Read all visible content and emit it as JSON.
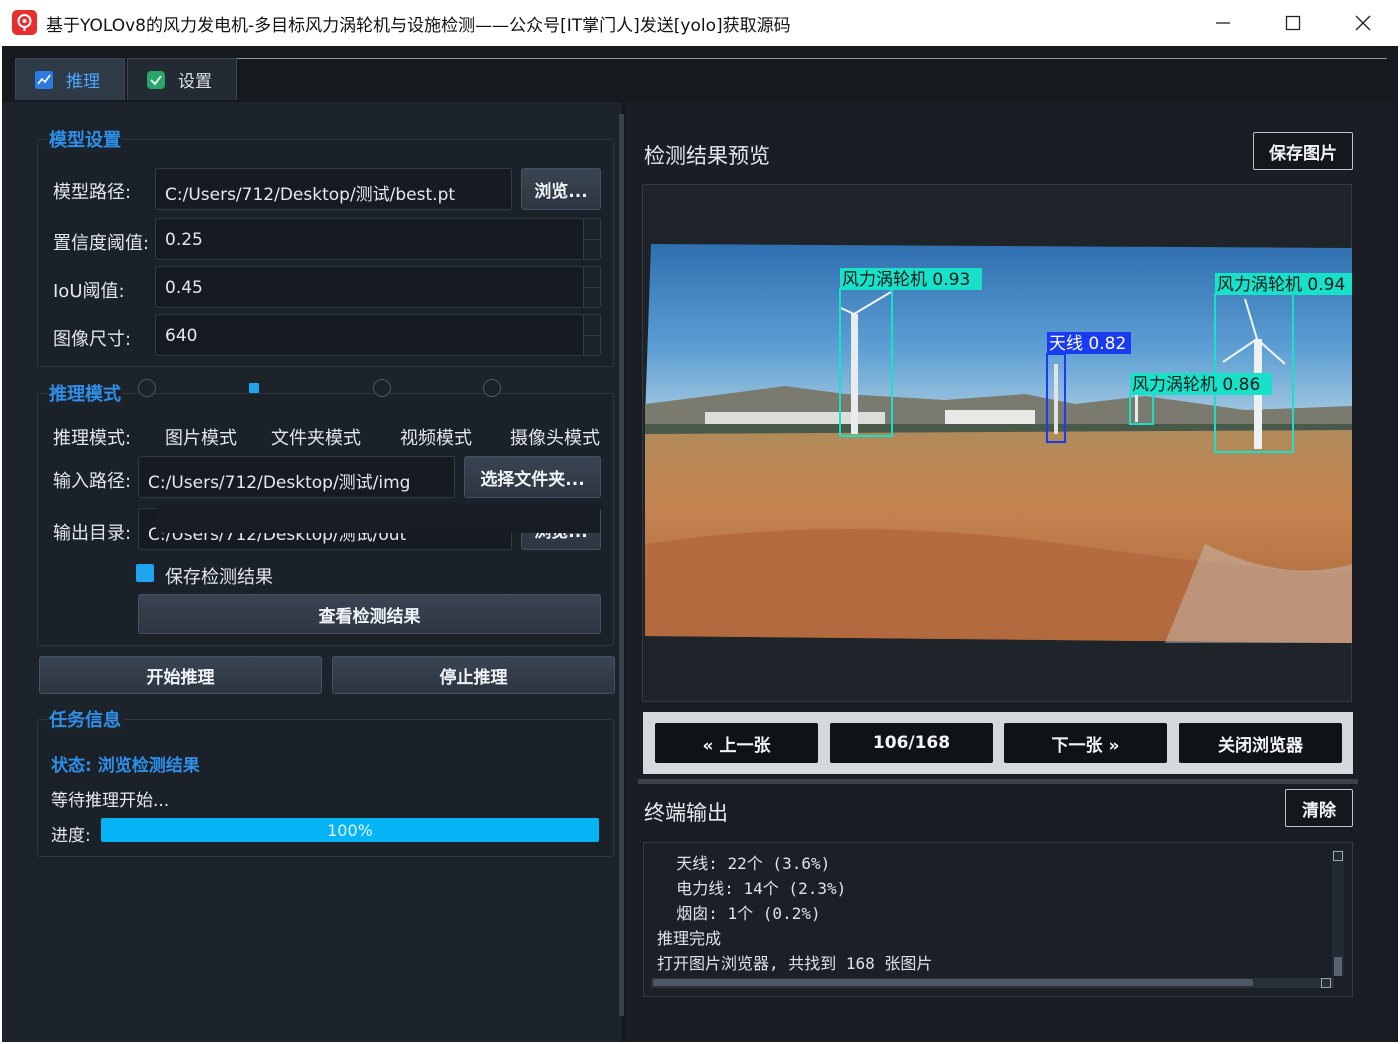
{
  "window": {
    "title": "基于YOLOv8的风力发电机-多目标风力涡轮机与设施检测——公众号[IT掌门人]发送[yolo]获取源码"
  },
  "tabs": [
    {
      "label": "推理",
      "icon": "chart-icon",
      "active": true
    },
    {
      "label": "设置",
      "icon": "checkmark-icon",
      "active": false
    }
  ],
  "model_settings": {
    "title": "模型设置",
    "model_path_label": "模型路径:",
    "model_path": "C:/Users/712/Desktop/测试/best.pt",
    "browse_label": "浏览...",
    "conf_label": "置信度阈值:",
    "conf_value": "0.25",
    "iou_label": "IoU阈值:",
    "iou_value": "0.45",
    "imgsz_label": "图像尺寸:",
    "imgsz_value": "640"
  },
  "inference_mode": {
    "title": "推理模式",
    "mode_label": "推理模式:",
    "modes": [
      {
        "label": "图片模式",
        "checked": false
      },
      {
        "label": "文件夹模式",
        "checked": true
      },
      {
        "label": "视频模式",
        "checked": false
      },
      {
        "label": "摄像头模式",
        "checked": false
      }
    ],
    "input_label": "输入路径:",
    "input_path": "C:/Users/712/Desktop/测试/img",
    "select_folder_label": "选择文件夹...",
    "output_label": "输出目录:",
    "output_path": "C:/Users/712/Desktop/测试/out",
    "output_browse_label": "浏览...",
    "save_results_label": "保存检测结果",
    "save_results_checked": true,
    "view_results_label": "查看检测结果"
  },
  "actions": {
    "start_label": "开始推理",
    "stop_label": "停止推理"
  },
  "task_info": {
    "title": "任务信息",
    "status": "状态: 浏览检测结果",
    "message": "等待推理开始...",
    "progress_label": "进度:",
    "progress_value": 100,
    "progress_text": "100%"
  },
  "preview": {
    "title": "检测结果预览",
    "save_image_label": "保存图片",
    "detections": [
      {
        "label": "风力涡轮机 0.93",
        "color": "#19e0c8"
      },
      {
        "label": "风力涡轮机 0.94",
        "color": "#19e0c8"
      },
      {
        "label": "天线 0.82",
        "color": "#1a3cf0"
      },
      {
        "label": "风力涡轮机 0.86",
        "color": "#19e0c8"
      }
    ]
  },
  "navigation": {
    "prev_label": "« 上一张",
    "counter": "106/168",
    "next_label": "下一张 »",
    "close_label": "关闭浏览器"
  },
  "terminal": {
    "title": "终端输出",
    "clear_label": "清除",
    "lines": [
      "  天线: 22个 (3.6%)",
      "  电力线: 14个 (2.3%)",
      "  烟囱: 1个 (0.2%)",
      "推理完成",
      "打开图片浏览器, 共找到 168 张图片"
    ]
  },
  "colors": {
    "accent": "#2f8fe8",
    "progress": "#05b4f5",
    "turbine_box": "#19e0c8",
    "antenna_box": "#1a3cf0"
  }
}
